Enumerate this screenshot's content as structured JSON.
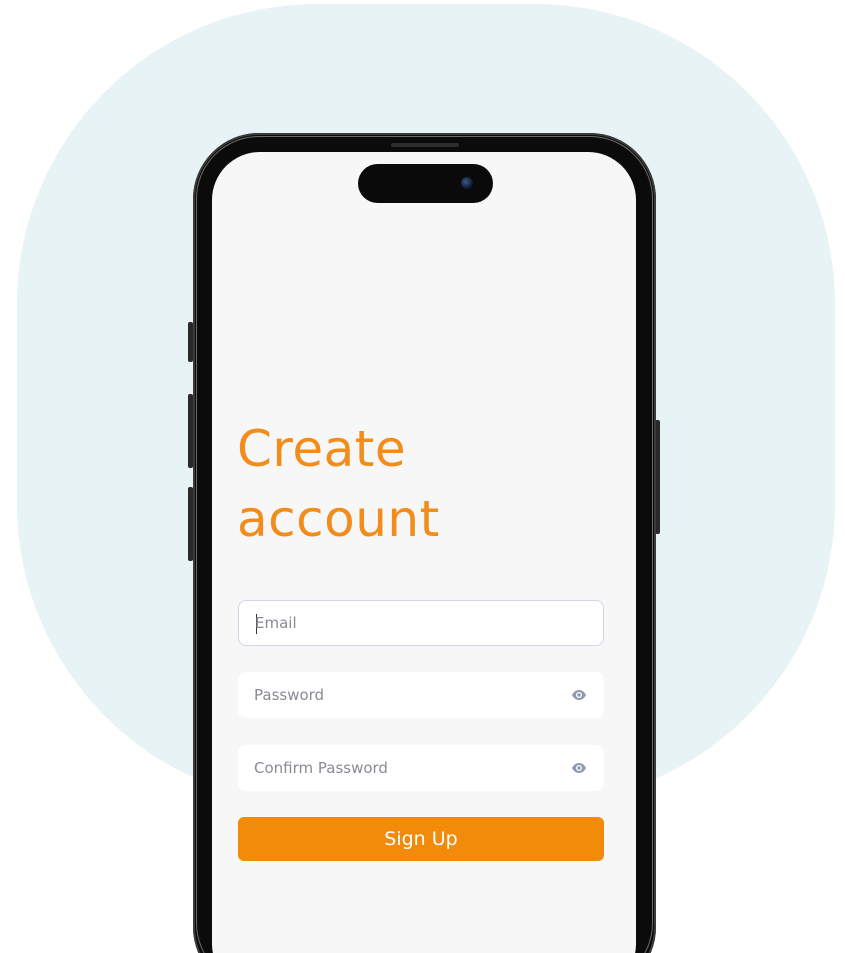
{
  "screen": {
    "title_line1": "Create",
    "title_line2": "account"
  },
  "form": {
    "email": {
      "value": "",
      "placeholder": "Email"
    },
    "password": {
      "value": "",
      "placeholder": "Password",
      "icon": "eye-icon"
    },
    "confirm_password": {
      "value": "",
      "placeholder": "Confirm Password",
      "icon": "eye-icon"
    },
    "submit_label": "Sign Up"
  },
  "colors": {
    "accent": "#f28a0a",
    "background_blob": "#e8f3f6",
    "screen_bg": "#f7f7f7",
    "field_bg": "#ffffff",
    "phone_frame": "#0b0b0b"
  }
}
